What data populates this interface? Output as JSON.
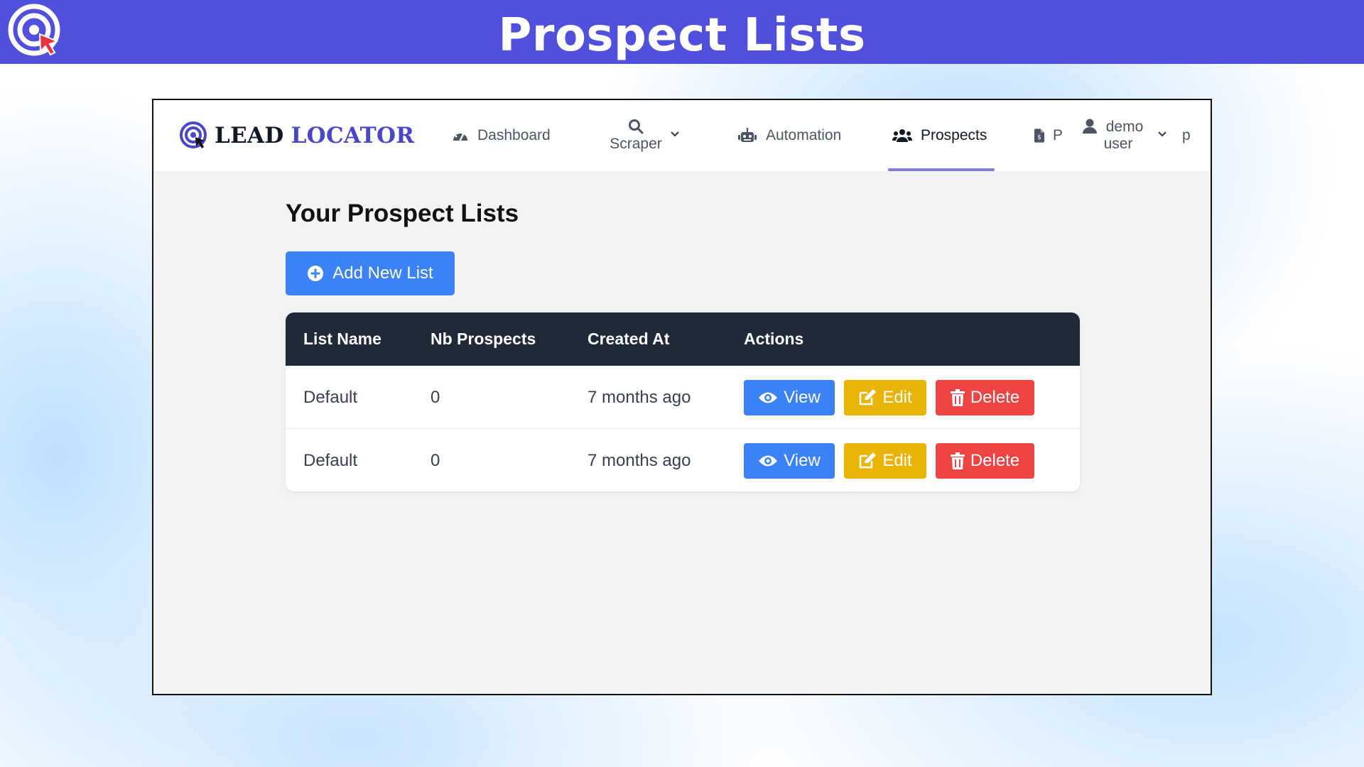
{
  "banner": {
    "title": "Prospect Lists"
  },
  "brand": {
    "lead": "LEAD",
    "locator": "LOCATOR"
  },
  "nav": {
    "dashboard": "Dashboard",
    "scraper": "Scraper",
    "automation": "Automation",
    "prospects": "Prospects",
    "truncated_item": "P",
    "user_line1": "demo",
    "user_line2": "user",
    "trailing": "p"
  },
  "main": {
    "title": "Your Prospect Lists",
    "add_button": "Add New List"
  },
  "table": {
    "columns": [
      "List Name",
      "Nb Prospects",
      "Created At",
      "Actions"
    ],
    "rows": [
      {
        "name": "Default",
        "count": "0",
        "created": "7 months ago"
      },
      {
        "name": "Default",
        "count": "0",
        "created": "7 months ago"
      }
    ],
    "actions": {
      "view": "View",
      "edit": "Edit",
      "delete": "Delete"
    }
  },
  "colors": {
    "banner": "#5050dc",
    "brand_accent": "#4a46c8",
    "view": "#3b82f6",
    "edit": "#eab308",
    "delete": "#ef4444",
    "table_header": "#1f2937"
  }
}
